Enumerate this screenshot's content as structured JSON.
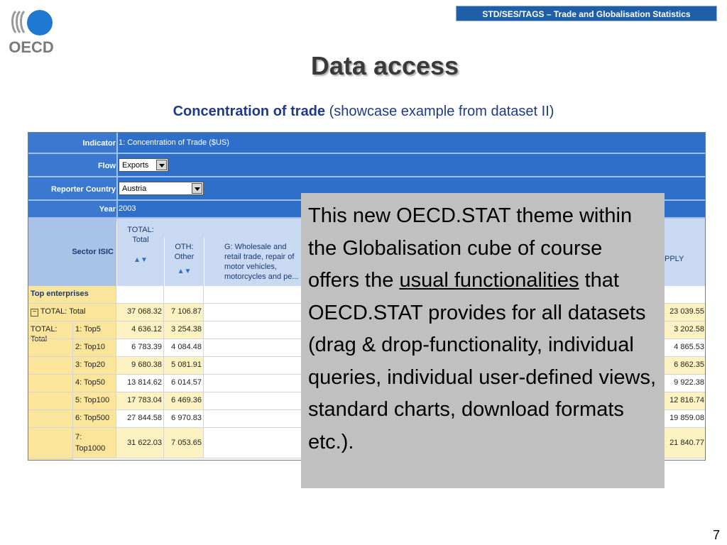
{
  "header": {
    "badge": "STD/SES/TAGS – Trade and Globalisation Statistics",
    "logo_text": "OECD"
  },
  "slide": {
    "title": "Data access",
    "subtitle_bold": "Concentration of trade",
    "subtitle_rest": "(showcase example from dataset II)",
    "page_number": "7"
  },
  "filters": {
    "indicator_label": "Indicator",
    "indicator_value": "1: Concentration of Trade ($US)",
    "flow_label": "Flow",
    "flow_value": "Exports",
    "reporter_label": "Reporter Country",
    "reporter_value": "Austria",
    "year_label": "Year",
    "year_value": "2003"
  },
  "columns": {
    "sector_label": "Sector ISIC",
    "total_head": "TOTAL: Total",
    "oth_head": "OTH: Other",
    "g_head": "G: Wholesale and retail trade, repair of motor vehicles, motorcycles and pe...",
    "last_head_fragment": "PPLY",
    "sort_glyph": "▲▼"
  },
  "rows": [
    {
      "label": "Top enterprises",
      "group": "",
      "total": "",
      "oth": "",
      "last": ""
    },
    {
      "label": "TOTAL: Total",
      "group": "",
      "total": "37 068.32",
      "oth": "7 106.87",
      "last": "23 039.55"
    },
    {
      "label": "1: Top5",
      "group": "TOTAL: Total",
      "total": "4 636.12",
      "oth": "3 254.38",
      "last": "3 202.58"
    },
    {
      "label": "2: Top10",
      "group": "",
      "total": "6 783.39",
      "oth": "4 084.48",
      "last": "4 865.53"
    },
    {
      "label": "3: Top20",
      "group": "",
      "total": "9 680.38",
      "oth": "5 081.91",
      "last": "6 862.35"
    },
    {
      "label": "4: Top50",
      "group": "",
      "total": "13 814.62",
      "oth": "6 014.57",
      "last": "9 922.38"
    },
    {
      "label": "5: Top100",
      "group": "",
      "total": "17 783.04",
      "oth": "6 469.36",
      "last": "12 816.74"
    },
    {
      "label": "6: Top500",
      "group": "",
      "total": "27 844.58",
      "oth": "6 970.83",
      "last": "19 859.08"
    },
    {
      "label": "7: Top1000",
      "group": "",
      "total": "31 622.03",
      "oth": "7 053.65",
      "last": "21 840.77"
    }
  ],
  "overlay": {
    "part1": "This new OECD.STAT theme within the Globalisation cube of course offers the ",
    "link": "usual functionalities",
    "part2": " that OECD.STAT provides for all datasets (drag & drop-functionality, individual queries, individual user-defined views, standard charts, download formats etc.)."
  },
  "colors": {
    "accent_blue": "#2e70c9",
    "badge_blue": "#1f5fa8",
    "title_gray": "#3a3a3a",
    "row_yellow": "#fdf3c2",
    "overlay_gray": "#c0c0c0"
  },
  "icons": {
    "collapse": "minus-square-icon",
    "dropdown": "chevron-down-icon"
  }
}
